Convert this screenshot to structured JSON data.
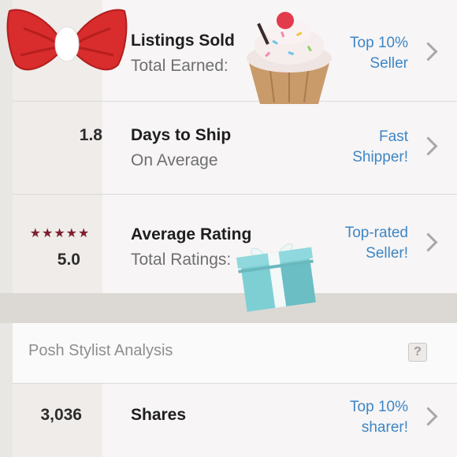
{
  "rows": [
    {
      "stat": "",
      "title": "Listings Sold",
      "subtitle": "Total Earned:",
      "badge": [
        "Top 10%",
        "Seller"
      ]
    },
    {
      "stat": "1.8",
      "title": "Days to Ship",
      "subtitle": "On Average",
      "badge": [
        "Fast",
        "Shipper!"
      ]
    },
    {
      "stat": "5.0",
      "stars": "★★★★★",
      "rating": 5,
      "title": "Average Rating",
      "subtitle": "Total Ratings:",
      "badge": [
        "Top-rated",
        "Seller!"
      ]
    }
  ],
  "section": {
    "title": "Posh Stylist Analysis",
    "help": "?"
  },
  "shares": {
    "stat": "3,036",
    "title": "Shares",
    "badge": [
      "Top 10%",
      "sharer!"
    ]
  },
  "colors": {
    "accent": "#3d86c6",
    "star": "#7c1f2c",
    "bow": "#e23b3b",
    "gift": "#7ecfd4"
  },
  "stickers": [
    "bow-sticker",
    "cupcake-sticker",
    "gift-box-sticker"
  ]
}
